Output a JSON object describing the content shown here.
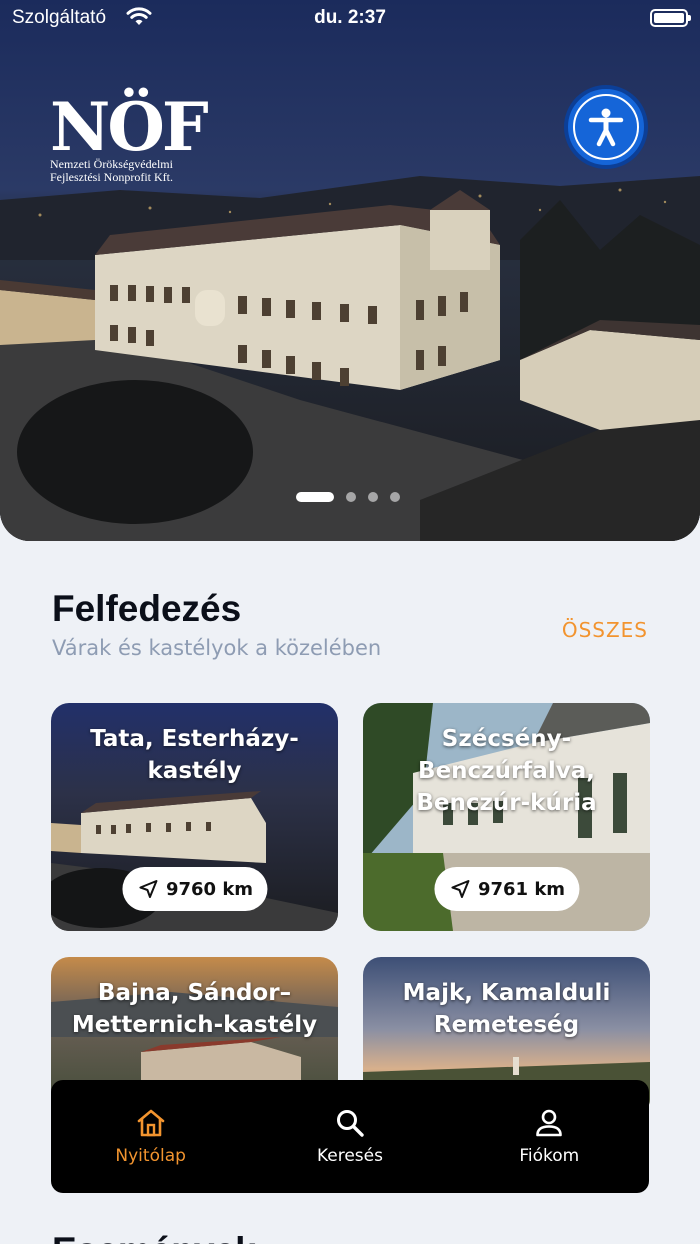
{
  "status_bar": {
    "carrier": "Szolgáltató",
    "time": "du. 2:37"
  },
  "logo": {
    "mark": "NÖF",
    "line1": "Nemzeti Örökségvédelmi",
    "line2": "Fejlesztési Nonprofit Kft."
  },
  "hero": {
    "slides_total": 4,
    "active_slide": 1
  },
  "explore": {
    "title": "Felfedezés",
    "subtitle": "Várak és kastélyok a közelében",
    "see_all": "ÖSSZES"
  },
  "cards": [
    {
      "title": "Tata, Esterházy-kastély",
      "distance": "9760 km"
    },
    {
      "title": "Szécsény-Benczúrfalva, Benczúr-kúria",
      "distance": "9761 km"
    },
    {
      "title": "Bajna, Sándor–Metternich-kastély"
    },
    {
      "title": "Majk, Kamalduli Remeteség"
    }
  ],
  "tabbar": {
    "items": [
      {
        "label": "Nyitólap",
        "icon": "home-icon",
        "active": true
      },
      {
        "label": "Keresés",
        "icon": "search-icon",
        "active": false
      },
      {
        "label": "Fiókom",
        "icon": "account-icon",
        "active": false
      }
    ]
  },
  "next_section": {
    "title": "Események"
  },
  "colors": {
    "accent": "#f2942f",
    "a11y_blue": "#1565d8",
    "background": "#eef1f6",
    "tabbar": "#000000"
  }
}
